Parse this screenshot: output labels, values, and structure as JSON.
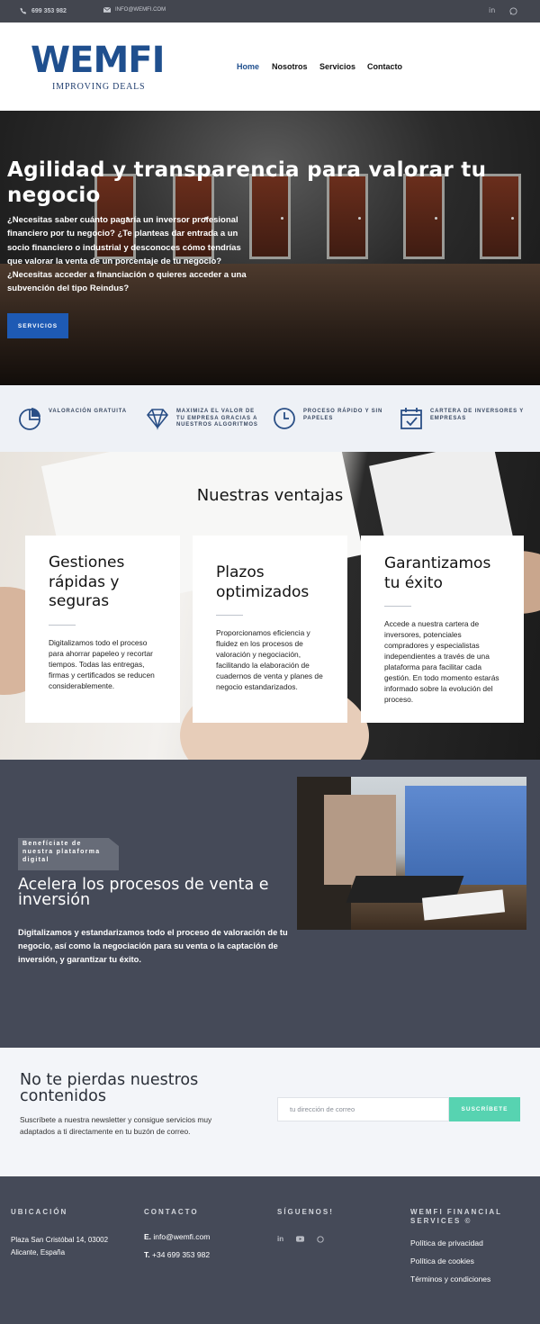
{
  "topbar": {
    "phone": "699 353 982",
    "email": "INFO@WEMFI.COM",
    "social_icons": [
      "linkedin-icon",
      "whatsapp-icon"
    ],
    "bg_color": "#43464f"
  },
  "header": {
    "logo_main": "WEMFI",
    "logo_sub": "IMPROVING DEALS",
    "nav": [
      {
        "label": "Home",
        "active": true
      },
      {
        "label": "Nosotros"
      },
      {
        "label": "Servicios"
      },
      {
        "label": "Contacto"
      }
    ],
    "accent_color": "#1f4f8e"
  },
  "hero": {
    "title": "Agilidad y transparencia para valorar tu negocio",
    "text": "¿Necesitas saber cuánto pagaría un inversor profesional financiero por tu negocio? ¿Te planteas dar entrada a un socio financiero o industrial y desconoces cómo tendrías que valorar la venta de un porcentaje de tu negocio? ¿Necesitas acceder a financiación o quieres acceder a una subvención del tipo Reindus?",
    "button": "SERVICIOS",
    "button_color": "#1e5ab4"
  },
  "features": [
    {
      "icon": "pie-chart-icon",
      "label": "VALORACIÓN GRATUITA"
    },
    {
      "icon": "diamond-icon",
      "label": "MAXIMIZA EL VALOR DE TU EMPRESA GRACIAS A NUESTROS ALGORITMOS"
    },
    {
      "icon": "clock-icon",
      "label": "PROCESO RÁPIDO Y SIN PAPELES"
    },
    {
      "icon": "calendar-check-icon",
      "label": "CARTERA DE INVERSORES Y EMPRESAS"
    }
  ],
  "ventajas": {
    "title": "Nuestras ventajas",
    "cards": [
      {
        "title": "Gestiones rápidas y seguras",
        "text": "Digitalizamos todo el proceso para ahorrar papeleo y recortar tiempos. Todas las entregas, firmas y certificados se reducen considerablemente."
      },
      {
        "title": "Plazos optimizados",
        "text": "Proporcionamos eficiencia y fluidez en los procesos de valoración y negociación, facilitando la elaboración de cuadernos de venta y planes de negocio estandarizados."
      },
      {
        "title": "Garantizamos tu éxito",
        "text": "Accede a nuestra cartera de inversores, potenciales compradores y especialistas independientes a través de una plataforma para facilitar cada gestión. En todo momento estarás informado sobre la evolución del proceso."
      }
    ]
  },
  "acelera": {
    "badge": "Benefíciate de nuestra plataforma digital",
    "title": "Acelera los procesos de venta e inversión",
    "text": "Digitalizamos y estandarizamos todo el proceso de valoración de tu negocio, así como la negociación para su venta o la captación de inversión, y garantizar tu éxito.",
    "bg_color": "#454a58"
  },
  "newsletter": {
    "title": "No te pierdas nuestros contenidos",
    "text": "Suscríbete a nuestra newsletter y consigue servicios muy adaptados a ti directamente en tu buzón de correo.",
    "placeholder": "tu dirección de correo",
    "button": "SUSCRÍBETE",
    "button_color": "#57d3b1"
  },
  "footer": {
    "location": {
      "heading": "UBICACIÓN",
      "address": "Plaza San Cristóbal 14, 03002 Alicante, España"
    },
    "contact": {
      "heading": "CONTACTO",
      "email_label": "E.",
      "email": "info@wemfi.com",
      "phone_label": "T.",
      "phone": "+34 699 353 982"
    },
    "follow": {
      "heading": "SÍGUENOS!",
      "icons": [
        "linkedin-icon",
        "youtube-icon",
        "whatsapp-icon"
      ]
    },
    "legal": {
      "heading": "WEMFI FINANCIAL SERVICES ©",
      "links": [
        "Política de privacidad",
        "Política de cookies",
        "Términos y condiciones"
      ]
    }
  }
}
